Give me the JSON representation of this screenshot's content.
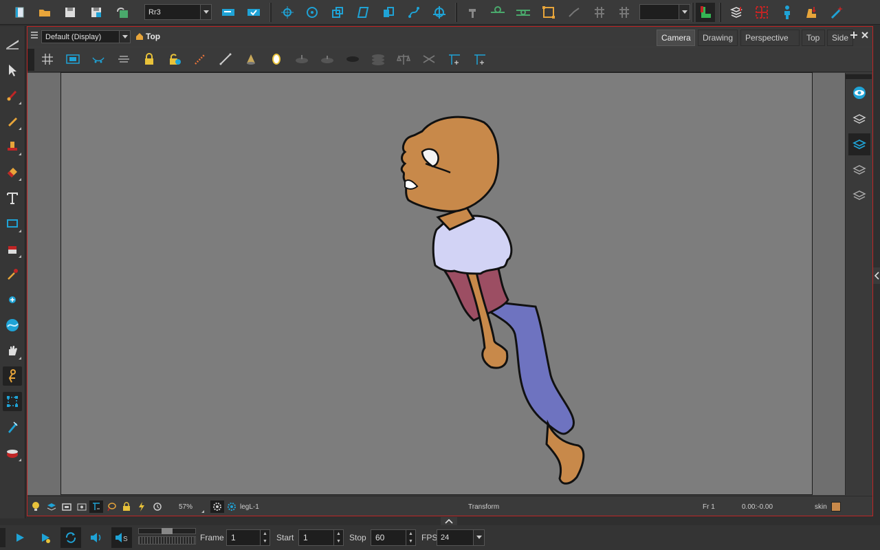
{
  "toolbar": {
    "drawing_name": "Rr3",
    "colors": {
      "accent": "#1fa3d6",
      "brand_red": "#c02525"
    }
  },
  "view": {
    "display_combo": "Default (Display)",
    "breadcrumb": "Top",
    "tabs": [
      {
        "label": "Camera"
      },
      {
        "label": "Drawing"
      },
      {
        "label": "Perspective"
      },
      {
        "label": "Top"
      },
      {
        "label": "Side"
      }
    ]
  },
  "status": {
    "zoom": "57%",
    "layer_name": "legL-1",
    "tool_name": "Transform",
    "frame": "Fr 1",
    "coords": "0.00:-0.00",
    "color_name": "skin",
    "color_swatch": "#c8894a"
  },
  "playback": {
    "frame_label": "Frame",
    "frame_value": "1",
    "start_label": "Start",
    "start_value": "1",
    "stop_label": "Stop",
    "stop_value": "60",
    "fps_label": "FPS",
    "fps_value": "24"
  }
}
